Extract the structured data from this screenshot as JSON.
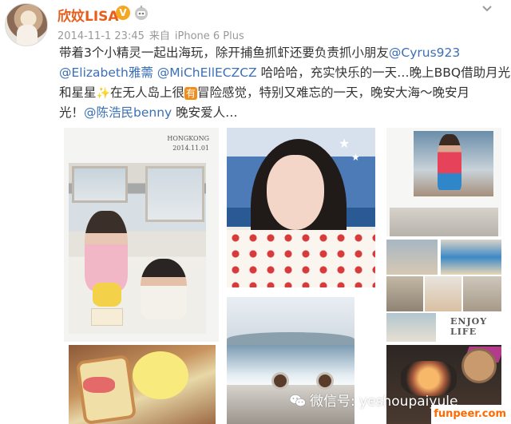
{
  "post": {
    "username": "欣妏LISA",
    "vip_badge": "V",
    "timestamp": "2014-11-1 23:45",
    "source_prefix": "来自",
    "source_device": "iPhone 6 Plus",
    "text_lines": [
      [
        {
          "type": "text",
          "value": "带着3个小精灵一起出海玩，除开捕鱼抓虾还要负责抓小朋友"
        },
        {
          "type": "mention",
          "value": "@Cyrus923"
        }
      ],
      [
        {
          "type": "mention",
          "value": "@Elizabeth雅薷"
        },
        {
          "type": "text",
          "value": " "
        },
        {
          "type": "mention",
          "value": "@MiChEllECZCZ"
        },
        {
          "type": "text",
          "value": " 哈哈哈，充实快乐的一天…晚上BBQ借助月光"
        }
      ],
      [
        {
          "type": "text",
          "value": "和星星"
        },
        {
          "type": "sparkle",
          "value": "✨"
        },
        {
          "type": "text",
          "value": "在无人岛上很"
        },
        {
          "type": "badge",
          "value": "有"
        },
        {
          "type": "text",
          "value": "冒险感觉，特别又难忘的一天，晚安大海～晚安月"
        }
      ],
      [
        {
          "type": "text",
          "value": "光！"
        },
        {
          "type": "mention",
          "value": "@陈浩民benny"
        },
        {
          "type": "text",
          "value": " 晚安爱人…"
        }
      ]
    ]
  },
  "collage": {
    "hongkong_label": "HONGKONG",
    "date_label": "2014.11.01",
    "enjoy_text": "ENJOY LIFE"
  },
  "watermark": {
    "wechat_text": "微信号: yeshoupaiyule",
    "site_text": "funpeer.com"
  },
  "colors": {
    "username": "#e85d1c",
    "mention": "#3b6fb6",
    "meta": "#999999",
    "vip": "#f5a623",
    "site": "#ff6a00"
  },
  "icons": [
    "avatar",
    "vip-badge-icon",
    "robot-icon",
    "chevron-down-icon",
    "sparkle-icon",
    "wechat-icon"
  ]
}
